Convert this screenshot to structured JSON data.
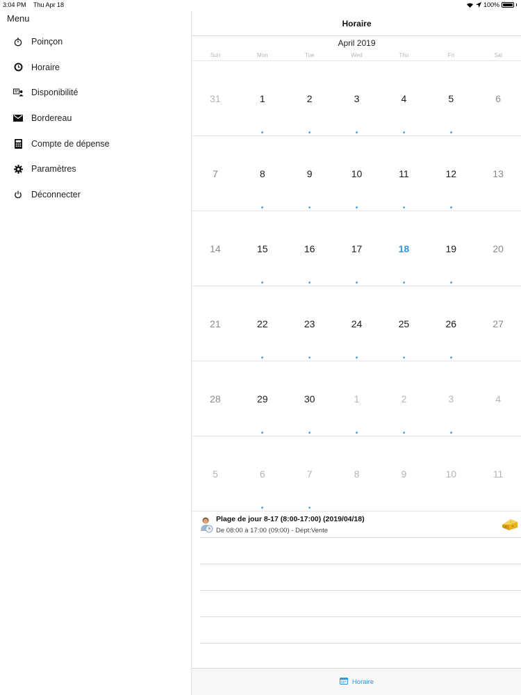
{
  "status": {
    "time": "3:04 PM",
    "date": "Thu Apr 18",
    "battery": "100%"
  },
  "sidebar": {
    "title": "Menu",
    "items": [
      {
        "label": "Poinçon",
        "icon": "stopwatch-icon"
      },
      {
        "label": "Horaire",
        "icon": "clock-icon"
      },
      {
        "label": "Disponibilité",
        "icon": "availability-icon"
      },
      {
        "label": "Bordereau",
        "icon": "envelope-icon"
      },
      {
        "label": "Compte de dépense",
        "icon": "calculator-icon"
      },
      {
        "label": "Paramètres",
        "icon": "gear-icon"
      },
      {
        "label": "Déconnecter",
        "icon": "power-icon"
      }
    ]
  },
  "header": {
    "title": "Horaire"
  },
  "calendar": {
    "month_label": "April 2019",
    "weekdays": [
      "Sun",
      "Mon",
      "Tue",
      "Wed",
      "Thu",
      "Fri",
      "Sat"
    ],
    "weeks": [
      [
        {
          "d": "31",
          "t": "out"
        },
        {
          "d": "1",
          "t": "in",
          "dot": true
        },
        {
          "d": "2",
          "t": "in",
          "dot": true
        },
        {
          "d": "3",
          "t": "in",
          "dot": true
        },
        {
          "d": "4",
          "t": "in",
          "dot": true
        },
        {
          "d": "5",
          "t": "in",
          "dot": true
        },
        {
          "d": "6",
          "t": "weekend"
        }
      ],
      [
        {
          "d": "7",
          "t": "weekend"
        },
        {
          "d": "8",
          "t": "in",
          "dot": true
        },
        {
          "d": "9",
          "t": "in",
          "dot": true
        },
        {
          "d": "10",
          "t": "in",
          "dot": true
        },
        {
          "d": "11",
          "t": "in",
          "dot": true
        },
        {
          "d": "12",
          "t": "in",
          "dot": true
        },
        {
          "d": "13",
          "t": "weekend"
        }
      ],
      [
        {
          "d": "14",
          "t": "weekend"
        },
        {
          "d": "15",
          "t": "in",
          "dot": true
        },
        {
          "d": "16",
          "t": "in",
          "dot": true
        },
        {
          "d": "17",
          "t": "in",
          "dot": true
        },
        {
          "d": "18",
          "t": "today",
          "dot": true
        },
        {
          "d": "19",
          "t": "in",
          "dot": true
        },
        {
          "d": "20",
          "t": "weekend"
        }
      ],
      [
        {
          "d": "21",
          "t": "weekend"
        },
        {
          "d": "22",
          "t": "in",
          "dot": true
        },
        {
          "d": "23",
          "t": "in",
          "dot": true
        },
        {
          "d": "24",
          "t": "in",
          "dot": true
        },
        {
          "d": "25",
          "t": "in",
          "dot": true
        },
        {
          "d": "26",
          "t": "in",
          "dot": true
        },
        {
          "d": "27",
          "t": "weekend"
        }
      ],
      [
        {
          "d": "28",
          "t": "weekend"
        },
        {
          "d": "29",
          "t": "in",
          "dot": true
        },
        {
          "d": "30",
          "t": "in",
          "dot": true
        },
        {
          "d": "1",
          "t": "out",
          "dot": true
        },
        {
          "d": "2",
          "t": "out",
          "dot": true
        },
        {
          "d": "3",
          "t": "out",
          "dot": true
        },
        {
          "d": "4",
          "t": "out"
        }
      ],
      [
        {
          "d": "5",
          "t": "out"
        },
        {
          "d": "6",
          "t": "out",
          "dot": true
        },
        {
          "d": "7",
          "t": "out",
          "dot": true
        },
        {
          "d": "8",
          "t": "out"
        },
        {
          "d": "9",
          "t": "out"
        },
        {
          "d": "10",
          "t": "out"
        },
        {
          "d": "11",
          "t": "out"
        }
      ]
    ]
  },
  "events": [
    {
      "title": "Plage de jour 8-17 (8:00-17:00) (2019/04/18)",
      "subtitle": "De 08:00 à 17:00 (09:00) - Dépt:Vente",
      "avatar_icon": "employee-avatar-icon",
      "badge_icon": "cheese-icon"
    }
  ],
  "tabbar": {
    "label": "Horaire",
    "icon": "calendar-icon"
  },
  "colors": {
    "accent": "#2f95dc",
    "dot": "#5aa9e0"
  }
}
